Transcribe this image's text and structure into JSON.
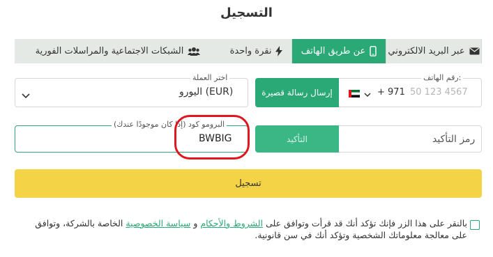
{
  "title": "التسجيل",
  "tabs": [
    {
      "label": "عبر البريد الالكتروني",
      "icon": "envelope-icon",
      "active": false
    },
    {
      "label": "عن طريق الهاتف",
      "icon": "phone-icon",
      "active": true
    },
    {
      "label": "نقرة واحدة",
      "icon": "lightning-icon",
      "active": false
    },
    {
      "label": "الشبكات الاجتماعية والمراسلات الفورية",
      "icon": "users-icon",
      "active": false
    }
  ],
  "phone": {
    "label": "رقم الهاتف:",
    "placeholder": "50 123 4567",
    "country_code": "+ 971",
    "flag": "uae-flag-icon",
    "sms_button": "إرسال رسالة قصيرة"
  },
  "currency": {
    "label": "اختر العملة",
    "value": "اليورو (EUR)"
  },
  "confirm": {
    "placeholder": "رمز التأكيد",
    "button": "التأكيد"
  },
  "promo": {
    "label": "البرومو كود (إذا كان موجودًا عندك)",
    "value": "BWBIG"
  },
  "submit_label": "تسجيل",
  "terms": {
    "prefix": "بالنقر على هذا الزر فإنك تؤكد أنك قد قرأت وتوافق على",
    "terms_link": "الشروط والأحكام",
    "and": "و",
    "privacy_link": "سياسة الخصوصية",
    "suffix": "الخاصة بالشركة، وتوافق على معالجة معلوماتك الشخصية وتؤكد أنك في سن قانونية."
  },
  "colors": {
    "accent": "#2aa876",
    "submit": "#f5d346",
    "highlight": "#e0161f"
  }
}
